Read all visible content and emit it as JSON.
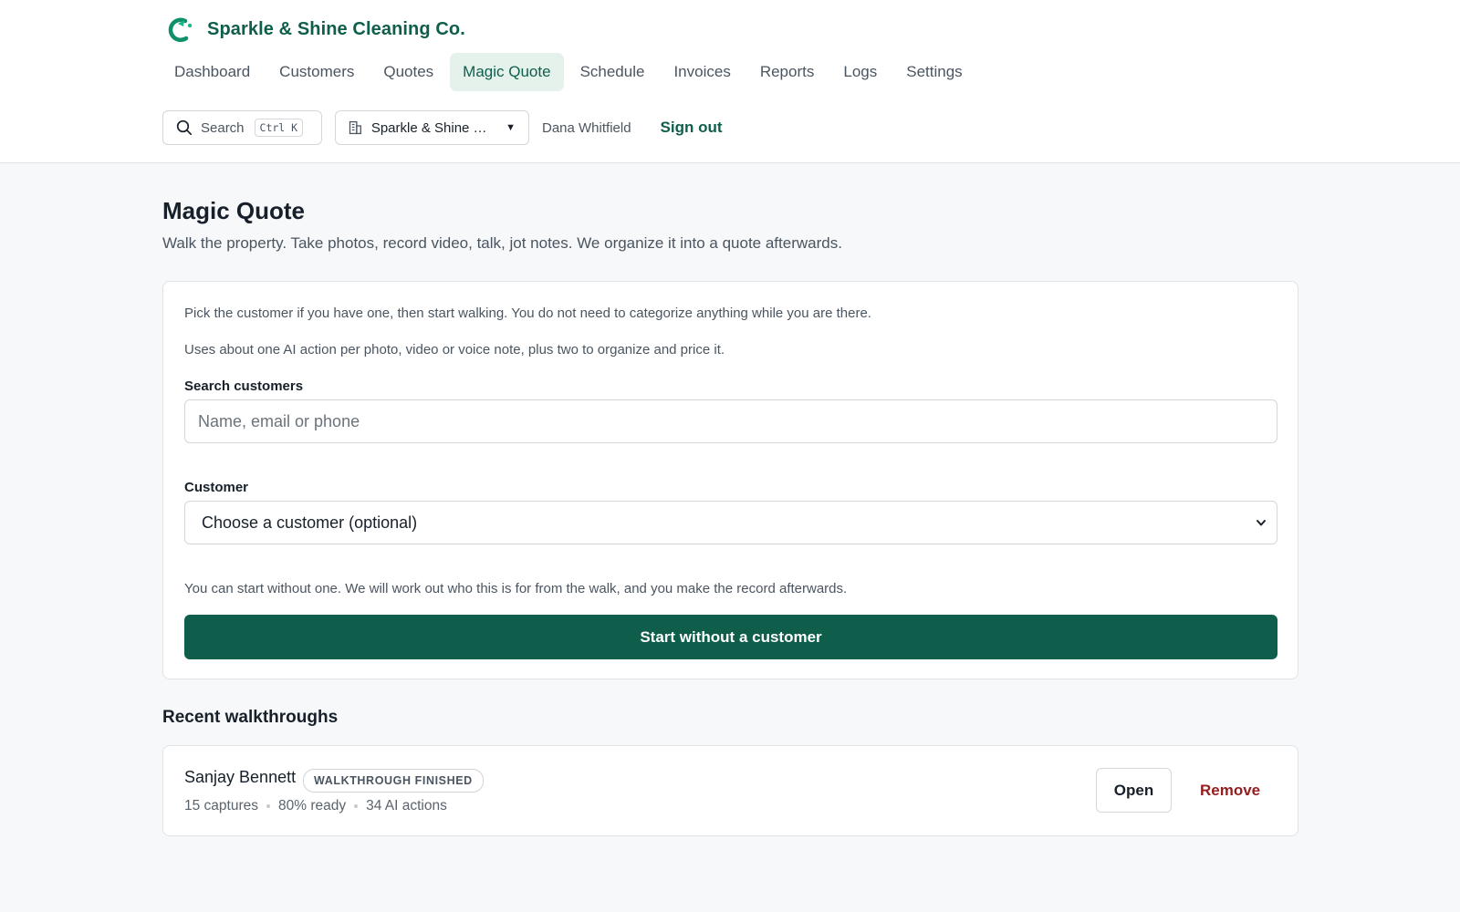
{
  "brand": {
    "name": "Sparkle & Shine Cleaning Co.",
    "logo_icon": "swirl-logo-icon",
    "accent_color": "#0f5e4c"
  },
  "nav": {
    "items": [
      {
        "label": "Dashboard",
        "active": false
      },
      {
        "label": "Customers",
        "active": false
      },
      {
        "label": "Quotes",
        "active": false
      },
      {
        "label": "Magic Quote",
        "active": true
      },
      {
        "label": "Schedule",
        "active": false
      },
      {
        "label": "Invoices",
        "active": false
      },
      {
        "label": "Reports",
        "active": false
      },
      {
        "label": "Logs",
        "active": false
      },
      {
        "label": "Settings",
        "active": false
      }
    ]
  },
  "toolbar": {
    "search_label": "Search",
    "search_shortcut": "Ctrl K",
    "org_name": "Sparkle & Shine Cleaning Co.",
    "user_name": "Dana Whitfield",
    "signout_label": "Sign out"
  },
  "page": {
    "title": "Magic Quote",
    "subtitle": "Walk the property. Take photos, record video, talk, jot notes. We organize it into a quote afterwards."
  },
  "form": {
    "help_1": "Pick the customer if you have one, then start walking. You do not need to categorize anything while you are there.",
    "help_2": "Uses about one AI action per photo, video or voice note, plus two to organize and price it.",
    "search_label": "Search customers",
    "search_placeholder": "Name, email or phone",
    "search_value": "",
    "customer_label": "Customer",
    "customer_selected": "Choose a customer (optional)",
    "no_customer_hint": "You can start without one. We will work out who this is for from the walk, and you make the record afterwards.",
    "start_button": "Start without a customer"
  },
  "recent": {
    "title": "Recent walkthroughs",
    "items": [
      {
        "customer": "Sanjay Bennett",
        "status": "WALKTHROUGH FINISHED",
        "captures": "15 captures",
        "ready": "80% ready",
        "ai_actions": "34 AI actions",
        "open_label": "Open",
        "remove_label": "Remove"
      }
    ]
  }
}
